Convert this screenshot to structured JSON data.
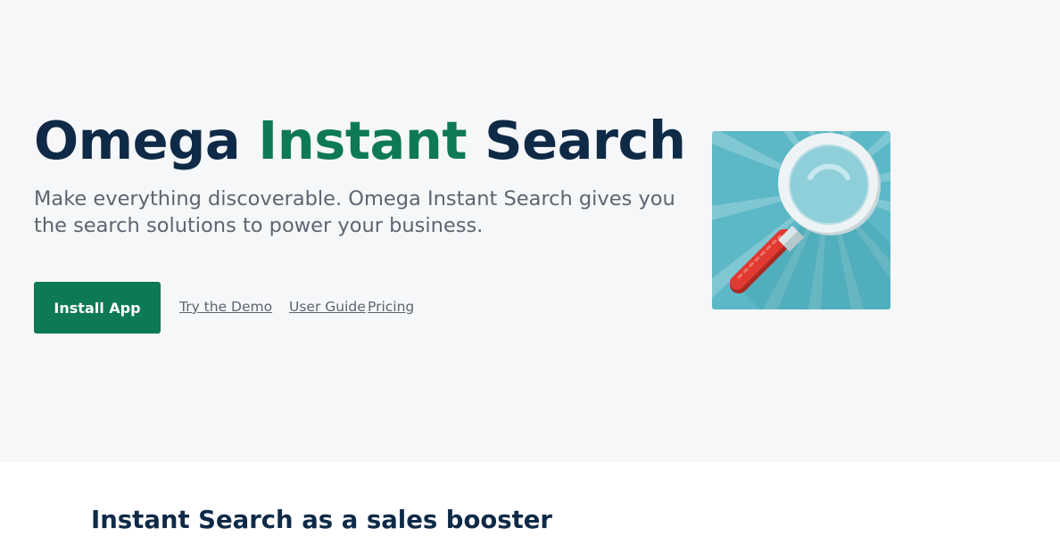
{
  "hero": {
    "title_part1": "Omega",
    "title_part2": "Instant",
    "title_part3": "Search",
    "subtitle": "Make everything discoverable. Omega Instant Search gives you the search solutions to power your business.",
    "install_button": "Install App",
    "links": {
      "demo": "Try the Demo",
      "guide": "User Guide",
      "pricing": "Pricing"
    },
    "app_icon": "magnifying-glass-icon"
  },
  "features": {
    "title": "Instant Search as a sales booster"
  },
  "colors": {
    "brand_navy": "#0f2a47",
    "brand_green": "#0e7a55",
    "hero_background": "#f6f7f9",
    "icon_teal": "#5cb8c6",
    "handle_red": "#e03a32"
  }
}
